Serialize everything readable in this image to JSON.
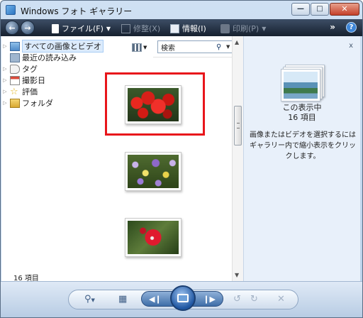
{
  "window": {
    "title": "Windows フォト ギャラリー"
  },
  "toolbar": {
    "file": "ファイル(F)",
    "fix": "修整(X)",
    "info": "情報(I)",
    "print": "印刷(P)",
    "more": "»",
    "help": "?"
  },
  "nav": {
    "items": [
      {
        "label": "すべての画像とビデオ",
        "icon": "photos-icon",
        "selected": true
      },
      {
        "label": "最近の読み込み",
        "icon": "import-icon"
      },
      {
        "label": "タグ",
        "icon": "tag-icon"
      },
      {
        "label": "撮影日",
        "icon": "calendar-icon"
      },
      {
        "label": "評価",
        "icon": "star-icon"
      },
      {
        "label": "フォルダ",
        "icon": "folder-icon"
      }
    ],
    "count": "16 項目"
  },
  "search": {
    "placeholder": "検索"
  },
  "gallery": {
    "thumbnails": [
      {
        "name": "dahlia"
      },
      {
        "name": "pansy"
      },
      {
        "name": "camellia"
      }
    ]
  },
  "info": {
    "close": "x",
    "title": "この表示中",
    "count": "16 項目",
    "hint": "画像またはビデオを選択するにはギャラリー内で縮小表示をクリックします。"
  },
  "colors": {
    "highlight": "#e8161b",
    "toolbar": "#1e2a3a",
    "accent": "#2d74c0"
  }
}
